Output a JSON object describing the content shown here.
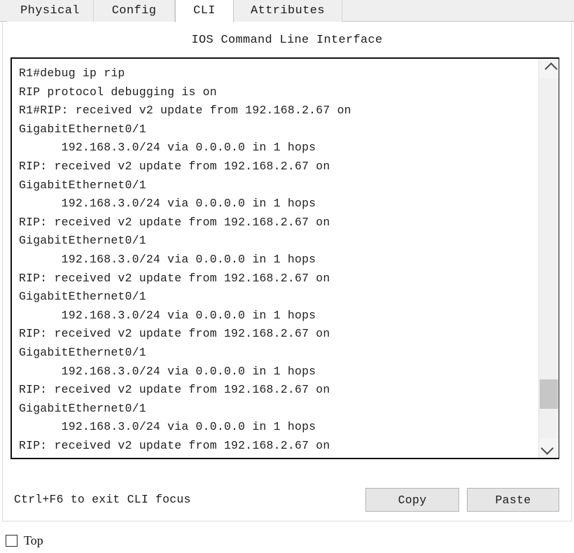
{
  "tabs": [
    {
      "label": "Physical",
      "active": false
    },
    {
      "label": "Config",
      "active": false
    },
    {
      "label": "CLI",
      "active": true
    },
    {
      "label": "Attributes",
      "active": false
    }
  ],
  "panel": {
    "title": "IOS Command Line Interface"
  },
  "console": {
    "content": "R1#debug ip rip\nRIP protocol debugging is on\nR1#RIP: received v2 update from 192.168.2.67 on\nGigabitEthernet0/1\n      192.168.3.0/24 via 0.0.0.0 in 1 hops\nRIP: received v2 update from 192.168.2.67 on\nGigabitEthernet0/1\n      192.168.3.0/24 via 0.0.0.0 in 1 hops\nRIP: received v2 update from 192.168.2.67 on\nGigabitEthernet0/1\n      192.168.3.0/24 via 0.0.0.0 in 1 hops\nRIP: received v2 update from 192.168.2.67 on\nGigabitEthernet0/1\n      192.168.3.0/24 via 0.0.0.0 in 1 hops\nRIP: received v2 update from 192.168.2.67 on\nGigabitEthernet0/1\n      192.168.3.0/24 via 0.0.0.0 in 1 hops\nRIP: received v2 update from 192.168.2.67 on\nGigabitEthernet0/1\n      192.168.3.0/24 via 0.0.0.0 in 1 hops\nRIP: received v2 update from 192.168.2.67 on\nGigabitEthernet0/1\n      192.168.3.0/24 via 0.0.0.0 in 1 hops\nRIP: received v2 update from 192.168.2.67 on"
  },
  "scrollbar": {
    "up_icon": "chevron-up-icon",
    "down_icon": "chevron-down-icon"
  },
  "footer": {
    "hint": "Ctrl+F6 to exit CLI focus",
    "copy_label": "Copy",
    "paste_label": "Paste"
  },
  "bottom": {
    "top_label": "Top",
    "top_checked": false
  }
}
